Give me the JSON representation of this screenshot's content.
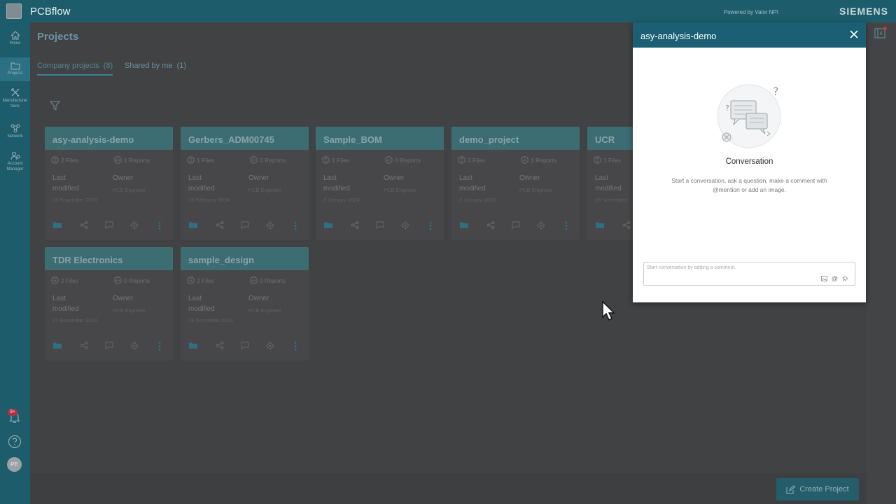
{
  "app": {
    "title": "PCBflow",
    "powered_by": "Powered by Valor NPI",
    "brand": "SIEMENS"
  },
  "nav": {
    "home": "Home",
    "projects": "Projects",
    "manufacturer_tools": "Manufacturer tools",
    "network": "Network",
    "account_manager": "Account Manager",
    "notifications_badge": "9+",
    "avatar_initials": "PE"
  },
  "page": {
    "title": "Projects",
    "tabs": [
      {
        "label": "Company projects",
        "count": "(8)"
      },
      {
        "label": "Shared by me",
        "count": "(1)"
      }
    ]
  },
  "labels": {
    "last": "Last",
    "modified": "modified",
    "owner": "Owner"
  },
  "projects": [
    {
      "name": "asy-analysis-demo",
      "files": "2 Files",
      "reports": "1 Reports",
      "date": "15 November 2023",
      "owner": "PCB Engineer"
    },
    {
      "name": "Gerbers_ADM00745",
      "files": "1 Files",
      "reports": "0 Reports",
      "date": "19 February 2024",
      "owner": "PCB Engineer"
    },
    {
      "name": "Sample_BOM",
      "files": "1 Files",
      "reports": "0 Reports",
      "date": "3 January 2024",
      "owner": "PCB Engineer"
    },
    {
      "name": "demo_project",
      "files": "2 Files",
      "reports": "1 Reports",
      "date": "2 January 2024",
      "owner": "PCB Engineer"
    },
    {
      "name": "UCR",
      "files": "1 Files",
      "reports": "",
      "date": "28 November",
      "owner": ""
    },
    {
      "name": "TDR Electronics",
      "files": "2 Files",
      "reports": "0 Reports",
      "date": "27 November 2023",
      "owner": "PCB Engineer"
    },
    {
      "name": "sample_design",
      "files": "2 Files",
      "reports": "0 Reports",
      "date": "16 November 2023",
      "owner": "PCB Engineer"
    }
  ],
  "create_button": "Create Project",
  "dialog": {
    "title": "asy-analysis-demo",
    "heading": "Conversation",
    "description": "Start a conversation, ask a question, make a comment with @mention or add an image.",
    "comment_placeholder": "Start conversation by adding a comment.",
    "at_symbol": "@"
  },
  "colors": {
    "header": "#1d5d6b",
    "dialog_header": "#1a5f73",
    "card_header": "#3c6d72",
    "accent": "#3e8295"
  }
}
